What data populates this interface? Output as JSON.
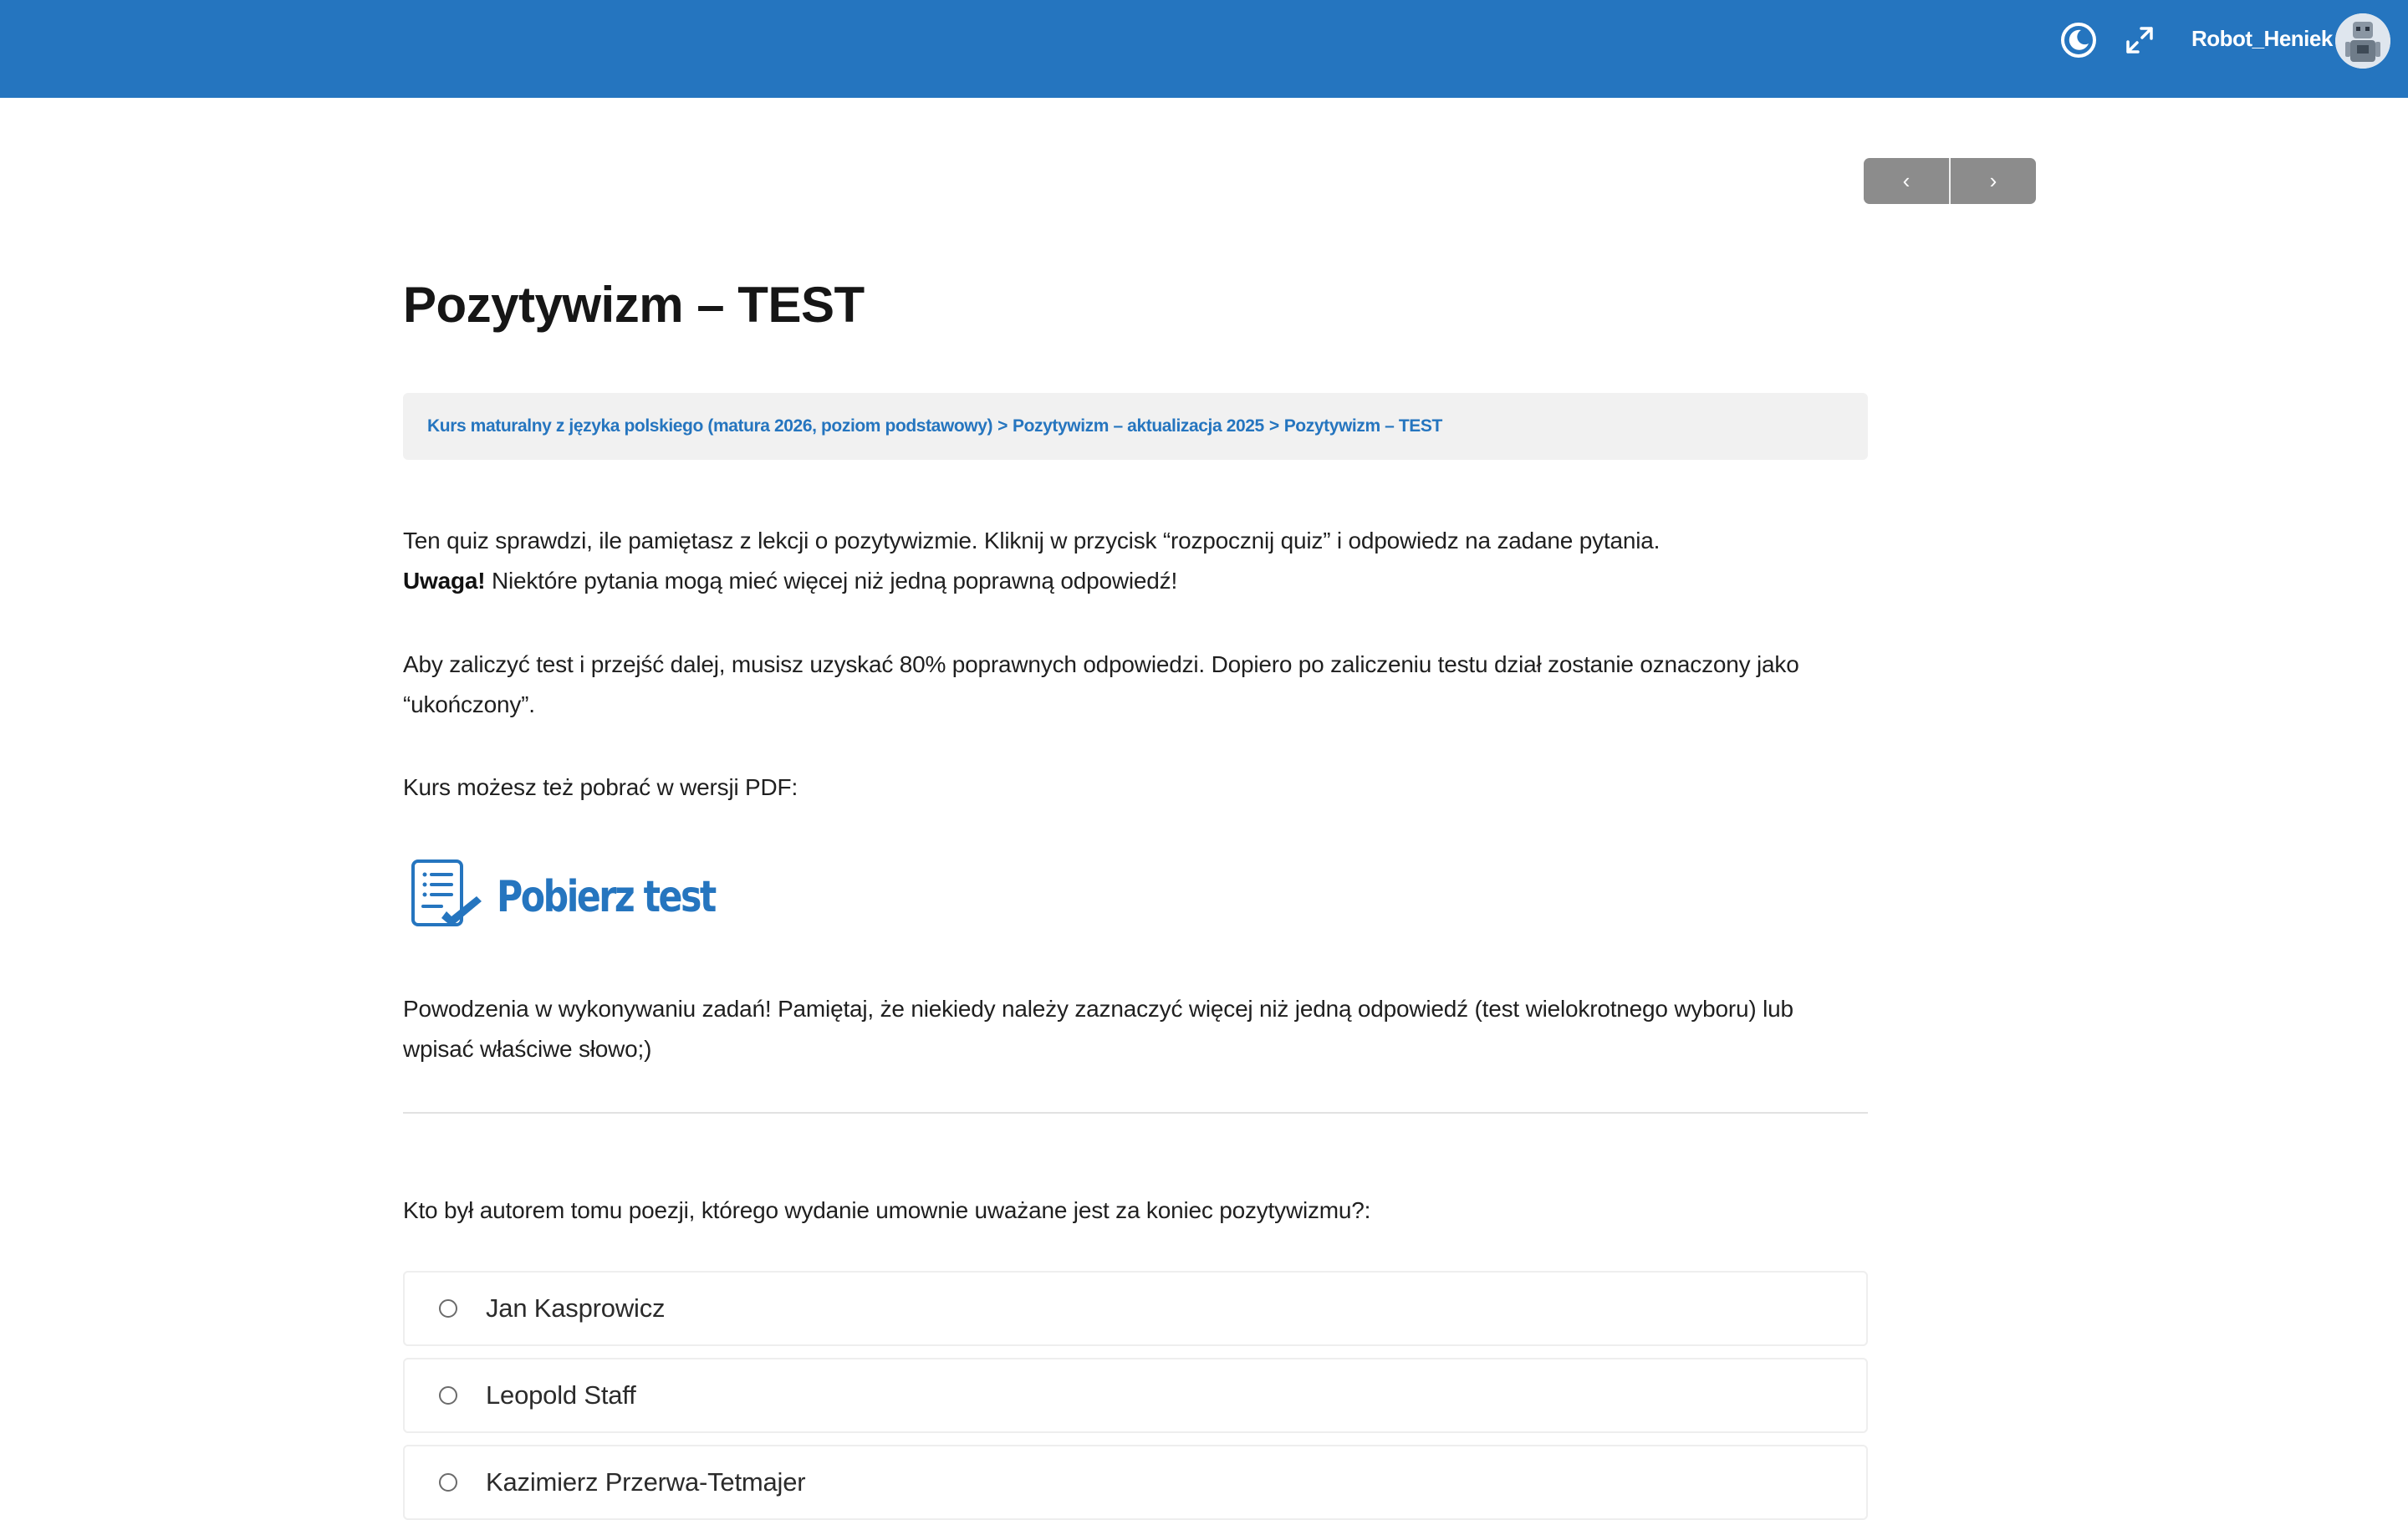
{
  "header": {
    "username": "Robot_Heniek",
    "brand_color": "#2575bf",
    "icons": [
      "dark-mode-icon",
      "fullscreen-icon"
    ]
  },
  "navigation": {
    "prev_symbol": "‹",
    "next_symbol": "›"
  },
  "page": {
    "title": "Pozytywizm – TEST"
  },
  "breadcrumb": {
    "items": [
      "Kurs maturalny z języka polskiego (matura 2026, poziom podstawowy)",
      "Pozytywizm – aktualizacja 2025",
      "Pozytywizm – TEST"
    ],
    "separator": ">"
  },
  "intro": {
    "p1_line1": "Ten quiz sprawdzi, ile pamiętasz z lekcji o pozytywizmie. Kliknij w przycisk “rozpocznij quiz” i odpowiedz na zadane pytania.",
    "p1_warning_bold": "Uwaga!",
    "p1_warning_rest": " Niektóre pytania mogą mieć więcej niż jedną poprawną odpowiedź!",
    "p2": "Aby zaliczyć test i przejść dalej, musisz uzyskać 80% poprawnych odpowiedzi. Dopiero po zaliczeniu testu dział zostanie oznaczony jako “ukończony”.",
    "p3": "Kurs możesz też pobrać w wersji PDF:",
    "download_label": "Pobierz test",
    "p4": "Powodzenia w wykonywaniu zadań! Pamiętaj, że niekiedy należy zaznaczyć więcej niż jedną odpowiedź (test wielokrotnego wyboru) lub wpisać właściwe słowo;)"
  },
  "quiz": {
    "question": "Kto był autorem tomu poezji, którego wydanie umownie uważane jest za koniec pozytywizmu?:",
    "answers": [
      "Jan Kasprowicz",
      "Leopold Staff",
      "Kazimierz Przerwa-Tetmajer"
    ]
  }
}
